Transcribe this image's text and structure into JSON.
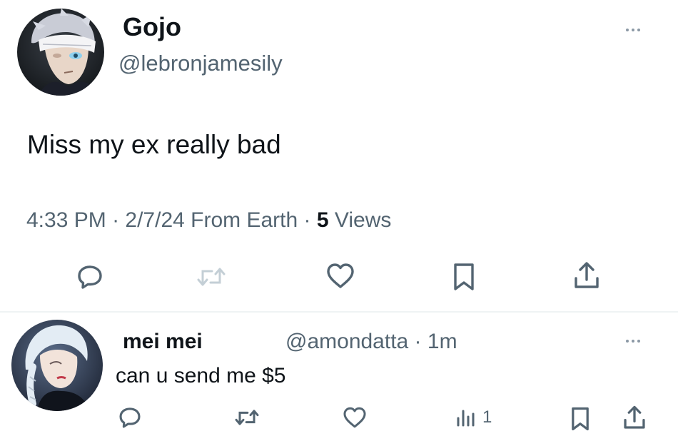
{
  "main_tweet": {
    "display_name": "Gojo",
    "handle": "@lebronjamesily",
    "text": "Miss my ex really bad",
    "meta": {
      "time": "4:33 PM",
      "separator": " · ",
      "date": "2/7/24",
      "source": " From Earth",
      "views_count": "5",
      "views_label": " Views"
    },
    "actions": [
      "reply-icon",
      "retweet-icon",
      "like-icon",
      "bookmark-icon",
      "share-icon"
    ]
  },
  "reply": {
    "display_name": "mei mei",
    "handle": "@amondatta · 1m",
    "text": "can u send me $5",
    "views": "1",
    "actions": [
      "reply-icon",
      "retweet-icon",
      "like-icon",
      "views-icon",
      "bookmark-icon",
      "share-icon"
    ]
  },
  "colors": {
    "text": "#0f1419",
    "secondary": "#536471",
    "icon": "#536471",
    "divider": "#eff3f4"
  }
}
